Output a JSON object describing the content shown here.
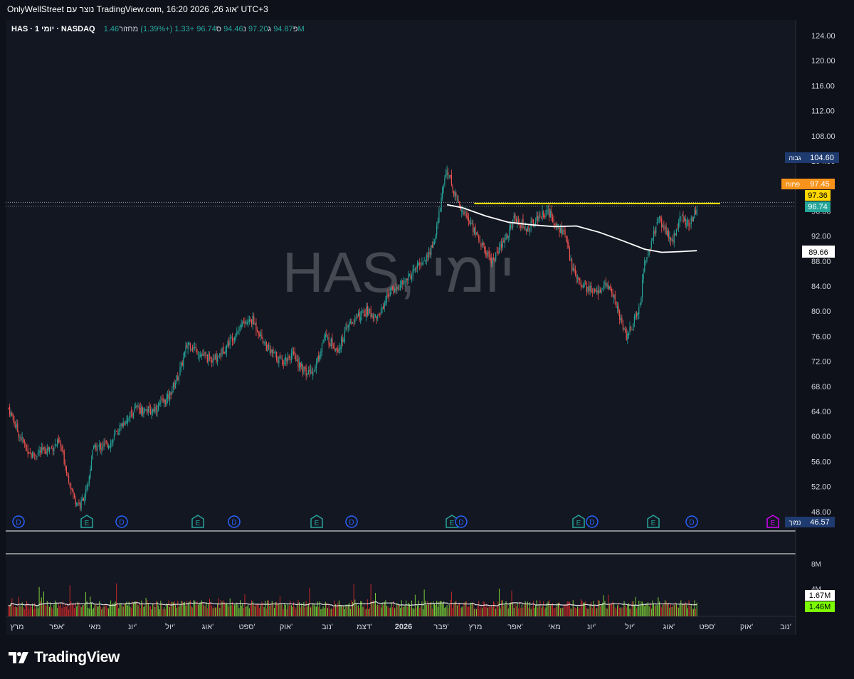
{
  "header": {
    "credit_text": "OnlyWellStreet נוצר עם TradingView.com, 16:20 2026 ,26 אוג' UTC+3"
  },
  "legend": {
    "symbol": "HAS · יומי 1 · NASDAQ",
    "o_label": "פ",
    "o_value": "94.87",
    "h_label": "ג",
    "h_value": "97.20",
    "l_label": "נ",
    "l_value": "94.46",
    "c_label": "ס",
    "c_value": "96.74",
    "change": "+1.33 (+1.39%)",
    "vol_label": "מחזור",
    "vol_value": "1.46M"
  },
  "watermark": "HAS, יומי",
  "colors": {
    "background": "#0f111a",
    "up": "#26a69a",
    "down": "#ef5350",
    "vol_up": "#7ccd38",
    "vol_down": "#c62828",
    "ma": "#ffffff",
    "resistance": "#ffe600",
    "high_badge": "#1e3a6e",
    "low_badge": "#1e3a6e",
    "open_badge": "#f7931a",
    "prev_close_badge": "#ffd600",
    "last_badge": "#26a69a",
    "earnings": "#26a69a",
    "dividend": "#2962ff"
  },
  "badges": {
    "high_label": "גבוה",
    "high_value": "104.60",
    "open_label": "פתוח",
    "open_value": "97.45",
    "prev_value": "97.36",
    "last_value": "96.74",
    "ma_value": "89.66",
    "low_label": "נמוך",
    "low_value": "46.57",
    "vol_ma_value": "1.67M",
    "vol_value": "1.46M",
    "vol_axis_8m": "8M",
    "vol_axis_4m": "4M"
  },
  "event_markers": [
    {
      "type": "D",
      "label": "D"
    },
    {
      "type": "E",
      "label": "E"
    },
    {
      "type": "D",
      "label": "D"
    },
    {
      "type": "E",
      "label": "E"
    },
    {
      "type": "D",
      "label": "D"
    },
    {
      "type": "E",
      "label": "E"
    },
    {
      "type": "D",
      "label": "D"
    },
    {
      "type": "E",
      "label": "E"
    },
    {
      "type": "D",
      "label": "D"
    },
    {
      "type": "E",
      "label": "E"
    },
    {
      "type": "D",
      "label": "D"
    },
    {
      "type": "E",
      "label": "E"
    },
    {
      "type": "D",
      "label": "D"
    },
    {
      "type": "E",
      "label": "E"
    }
  ],
  "chart_data": {
    "type": "candlestick",
    "symbol": "HAS",
    "interval": "1D",
    "exchange": "NASDAQ",
    "y_axis_ticks": [
      "124.00",
      "120.00",
      "116.00",
      "112.00",
      "108.00",
      "104.00",
      "100.00",
      "96.00",
      "92.00",
      "88.00",
      "84.00",
      "80.00",
      "76.00",
      "72.00",
      "68.00",
      "64.00",
      "60.00",
      "56.00",
      "52.00",
      "48.00"
    ],
    "ylim": [
      46,
      127
    ],
    "x_axis_ticks": [
      "מרץ",
      "אפר'",
      "מאי",
      "יונ'",
      "יול'",
      "אוג'",
      "ספט'",
      "אוק'",
      "נוב'",
      "דצמ'",
      "2026",
      "פבר'",
      "מרץ",
      "אפר'",
      "מאי",
      "יונ'",
      "יול'",
      "אוג'",
      "ספט'",
      "אוק'",
      "נוב'"
    ],
    "resistance_level": 97.2,
    "price_path": [
      {
        "t": 0,
        "p": 64.5
      },
      {
        "t": 10,
        "p": 60
      },
      {
        "t": 20,
        "p": 57
      },
      {
        "t": 35,
        "p": 58
      },
      {
        "t": 45,
        "p": 59
      },
      {
        "t": 52,
        "p": 54
      },
      {
        "t": 58,
        "p": 50
      },
      {
        "t": 63,
        "p": 49
      },
      {
        "t": 70,
        "p": 52
      },
      {
        "t": 74,
        "p": 58
      },
      {
        "t": 90,
        "p": 59
      },
      {
        "t": 100,
        "p": 62
      },
      {
        "t": 112,
        "p": 64.5
      },
      {
        "t": 125,
        "p": 64
      },
      {
        "t": 140,
        "p": 66
      },
      {
        "t": 150,
        "p": 70
      },
      {
        "t": 158,
        "p": 75
      },
      {
        "t": 170,
        "p": 73
      },
      {
        "t": 180,
        "p": 72
      },
      {
        "t": 190,
        "p": 74
      },
      {
        "t": 205,
        "p": 78
      },
      {
        "t": 215,
        "p": 78.5
      },
      {
        "t": 228,
        "p": 74
      },
      {
        "t": 240,
        "p": 72
      },
      {
        "t": 250,
        "p": 73
      },
      {
        "t": 262,
        "p": 70
      },
      {
        "t": 270,
        "p": 71
      },
      {
        "t": 278,
        "p": 76
      },
      {
        "t": 290,
        "p": 74
      },
      {
        "t": 300,
        "p": 78
      },
      {
        "t": 315,
        "p": 80
      },
      {
        "t": 325,
        "p": 79
      },
      {
        "t": 335,
        "p": 83
      },
      {
        "t": 345,
        "p": 84
      },
      {
        "t": 355,
        "p": 86
      },
      {
        "t": 362,
        "p": 87.5
      },
      {
        "t": 370,
        "p": 89
      },
      {
        "t": 376,
        "p": 92
      },
      {
        "t": 382,
        "p": 99
      },
      {
        "t": 386,
        "p": 103
      },
      {
        "t": 392,
        "p": 99
      },
      {
        "t": 400,
        "p": 96
      },
      {
        "t": 410,
        "p": 93
      },
      {
        "t": 418,
        "p": 90
      },
      {
        "t": 426,
        "p": 88
      },
      {
        "t": 436,
        "p": 91
      },
      {
        "t": 446,
        "p": 95
      },
      {
        "t": 456,
        "p": 93
      },
      {
        "t": 466,
        "p": 95
      },
      {
        "t": 474,
        "p": 96
      },
      {
        "t": 482,
        "p": 94
      },
      {
        "t": 490,
        "p": 92
      },
      {
        "t": 496,
        "p": 87
      },
      {
        "t": 506,
        "p": 84
      },
      {
        "t": 516,
        "p": 83
      },
      {
        "t": 526,
        "p": 84
      },
      {
        "t": 532,
        "p": 83
      },
      {
        "t": 538,
        "p": 79
      },
      {
        "t": 544,
        "p": 76
      },
      {
        "t": 550,
        "p": 78
      },
      {
        "t": 556,
        "p": 81
      },
      {
        "t": 560,
        "p": 88
      },
      {
        "t": 566,
        "p": 91
      },
      {
        "t": 572,
        "p": 95
      },
      {
        "t": 578,
        "p": 93
      },
      {
        "t": 584,
        "p": 91
      },
      {
        "t": 592,
        "p": 95
      },
      {
        "t": 600,
        "p": 94
      },
      {
        "t": 606,
        "p": 96.74
      }
    ],
    "ma_path": [
      {
        "t": 386,
        "p": 97
      },
      {
        "t": 400,
        "p": 96.5
      },
      {
        "t": 420,
        "p": 95.2
      },
      {
        "t": 440,
        "p": 94.2
      },
      {
        "t": 460,
        "p": 93.8
      },
      {
        "t": 480,
        "p": 93.5
      },
      {
        "t": 500,
        "p": 93.6
      },
      {
        "t": 520,
        "p": 92.6
      },
      {
        "t": 540,
        "p": 91.3
      },
      {
        "t": 560,
        "p": 89.9
      },
      {
        "t": 575,
        "p": 89.4
      },
      {
        "t": 590,
        "p": 89.5
      },
      {
        "t": 606,
        "p": 89.66
      }
    ]
  }
}
